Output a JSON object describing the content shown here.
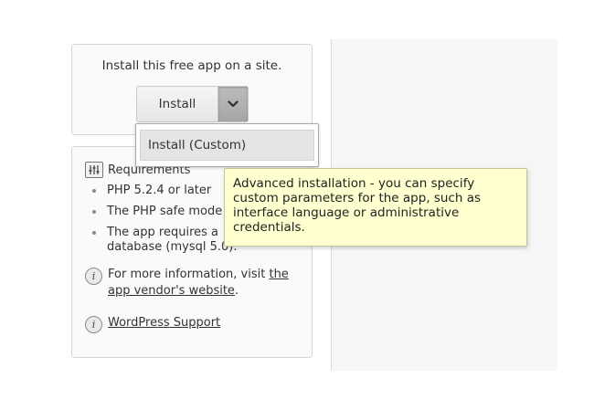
{
  "install_box": {
    "text": "Install this free app on a site.",
    "install_label": "Install",
    "toggle_icon": "chevron-down-icon"
  },
  "dropdown": {
    "items": [
      {
        "label": "Install (Custom)"
      }
    ]
  },
  "tooltip": {
    "lines": [
      "Advanced installation - you can specify",
      "custom parameters for the app, such as",
      "interface language or administrative",
      "credentials."
    ]
  },
  "requirements": {
    "title": "Requirements",
    "icon": "sliders-icon",
    "items": [
      "PHP 5.2.4 or later",
      "The PHP safe mode",
      "The app requires a",
      "database (mysql 5.0)."
    ]
  },
  "more_info": {
    "icon": "info-icon",
    "text": "For more information, visit ",
    "link_text": "the app vendor's website",
    "suffix": "."
  },
  "support": {
    "icon": "info-icon",
    "link_text": "WordPress Support"
  },
  "colors": {
    "tooltip_bg": "#ffffcf",
    "toggle_bg": "#a6a6a6",
    "right_pane_bg": "#f6f6f6"
  }
}
